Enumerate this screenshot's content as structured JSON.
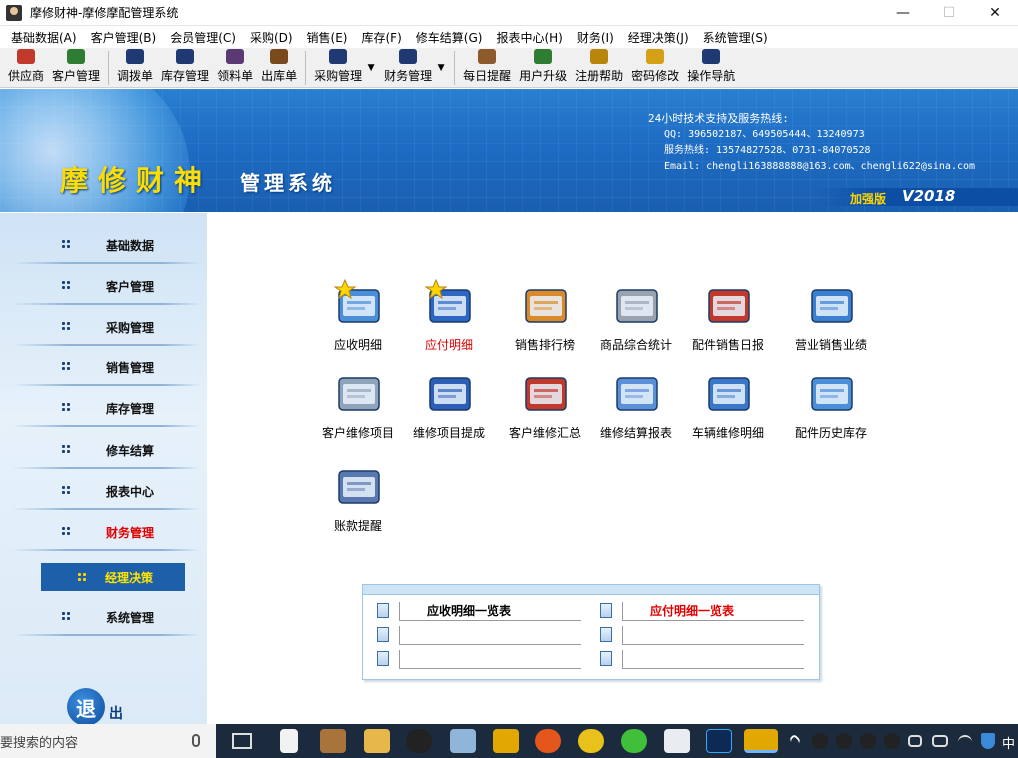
{
  "window": {
    "title": "摩修财神-摩修摩配管理系统",
    "controls": {
      "minimize": "—",
      "maximize": "☐",
      "close": "✕"
    }
  },
  "menu": [
    "基础数据(A)",
    "客户管理(B)",
    "会员管理(C)",
    "采购(D)",
    "销售(E)",
    "库存(F)",
    "修车结算(G)",
    "报表中心(H)",
    "财务(I)",
    "经理决策(J)",
    "系统管理(S)"
  ],
  "toolbar": {
    "items": [
      {
        "label": "供应商",
        "icon": "supplier-icon",
        "color": "#c0392b"
      },
      {
        "label": "客户管理",
        "icon": "customer-globe-icon",
        "color": "#2e7d32"
      },
      {
        "label": "调拨单",
        "icon": "transfer-icon",
        "color": "#1f3a73"
      },
      {
        "label": "库存管理",
        "icon": "inventory-icon",
        "color": "#1f3a73"
      },
      {
        "label": "领料单",
        "icon": "requisition-icon",
        "color": "#5b3a73"
      },
      {
        "label": "出库单",
        "icon": "outbound-icon",
        "color": "#7a4a1e"
      },
      {
        "label": "采购管理",
        "icon": "purchase-icon",
        "color": "#1f3a73"
      },
      {
        "label": "财务管理",
        "icon": "finance-icon",
        "color": "#1f3a73"
      },
      {
        "label": "每日提醒",
        "icon": "reminder-icon",
        "color": "#8d5a2b"
      },
      {
        "label": "用户升级",
        "icon": "upgrade-globe-icon",
        "color": "#2e7d32"
      },
      {
        "label": "注册帮助",
        "icon": "register-icon",
        "color": "#b8860b"
      },
      {
        "label": "密码修改",
        "icon": "lock-icon",
        "color": "#d4a017"
      },
      {
        "label": "操作导航",
        "icon": "navigation-icon",
        "color": "#1f3a73"
      }
    ]
  },
  "banner": {
    "brand_big": "摩修财神",
    "brand_small": "管理系统",
    "support_title": "24小时技术支持及服务热线:",
    "qq": "QQ: 396502187、649505444、13240973",
    "hotline": "服务热线: 13574827528、0731-84070528",
    "email": "Email: chengli163888888@163.com、chengli622@sina.com",
    "edition": "加强版",
    "version": "V2018"
  },
  "sidebar": {
    "items": [
      {
        "label": "基础数据",
        "active": false,
        "highlight": false
      },
      {
        "label": "客户管理",
        "active": false,
        "highlight": false
      },
      {
        "label": "采购管理",
        "active": false,
        "highlight": false
      },
      {
        "label": "销售管理",
        "active": false,
        "highlight": false
      },
      {
        "label": "库存管理",
        "active": false,
        "highlight": false
      },
      {
        "label": "修车结算",
        "active": false,
        "highlight": false
      },
      {
        "label": "报表中心",
        "active": false,
        "highlight": false
      },
      {
        "label": "财务管理",
        "active": false,
        "highlight": true
      },
      {
        "label": "经理决策",
        "active": true,
        "highlight": false
      },
      {
        "label": "系统管理",
        "active": false,
        "highlight": false
      }
    ],
    "exit_label": "退",
    "exit_tail": "出"
  },
  "tiles": [
    {
      "label": "应收明细",
      "icon": "folder-star-icon",
      "red": false
    },
    {
      "label": "应付明细",
      "icon": "window-star-icon",
      "red": true
    },
    {
      "label": "销售排行榜",
      "icon": "clipboard-icon",
      "red": false
    },
    {
      "label": "商品综合统计",
      "icon": "printer-icon",
      "red": false
    },
    {
      "label": "配件销售日报",
      "icon": "checklist-pencil-icon",
      "red": false
    },
    {
      "label": "营业销售业绩",
      "icon": "globe-arrow-icon",
      "red": false
    },
    {
      "label": "客户维修项目",
      "icon": "magnifier-icon",
      "red": false
    },
    {
      "label": "维修项目提成",
      "icon": "spreadsheet-icon",
      "red": false
    },
    {
      "label": "客户维修汇总",
      "icon": "brush-window-icon",
      "red": false
    },
    {
      "label": "维修结算报表",
      "icon": "document-search-icon",
      "red": false
    },
    {
      "label": "车辆维修明细",
      "icon": "document-pencil-icon",
      "red": false
    },
    {
      "label": "配件历史库存",
      "icon": "folder-history-icon",
      "red": false
    },
    {
      "label": "账款提醒",
      "icon": "folder-film-icon",
      "red": false
    }
  ],
  "panel": {
    "rows": [
      {
        "left": "应收明细一览表",
        "right": "应付明细一览表"
      },
      {
        "left": "",
        "right": ""
      },
      {
        "left": "",
        "right": ""
      }
    ]
  },
  "taskbar": {
    "search_placeholder": "要搜索的内容",
    "ime": "中"
  },
  "colors": {
    "accent": "#1d5fa8",
    "highlight_red": "#e00000",
    "brand_yellow": "#ffdd00"
  }
}
